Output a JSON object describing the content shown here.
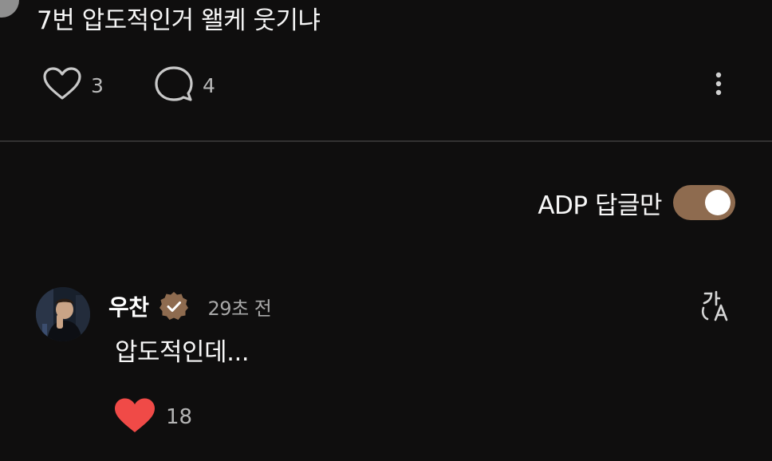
{
  "post": {
    "text": "7번 압도적인거 왤케 웃기냐",
    "like_count": "3",
    "reply_count": "4"
  },
  "filter": {
    "label": "ADP 답글만",
    "enabled": true
  },
  "comment": {
    "username": "우찬",
    "verified": true,
    "time": "29초 전",
    "text": "압도적인데...",
    "like_count": "18",
    "liked": true
  },
  "icons": {
    "like": "heart-outline-icon",
    "reply": "speech-bubble-icon",
    "more": "vertical-dots-icon",
    "verified": "verified-badge-icon",
    "translate": "translate-icon",
    "liked": "heart-filled-icon"
  },
  "colors": {
    "background": "#0f0e0e",
    "accent": "#8e6b4f",
    "like_red": "#f04a47"
  }
}
